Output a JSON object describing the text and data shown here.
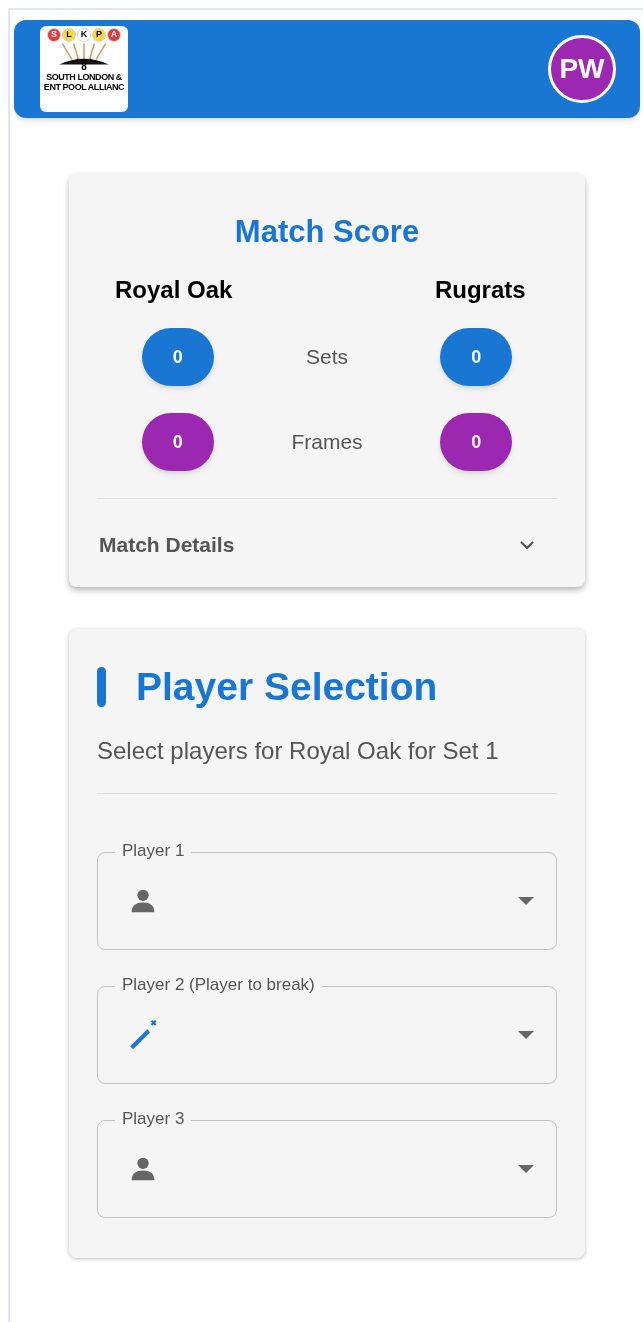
{
  "header": {
    "logo": {
      "balls": [
        {
          "letter": "S",
          "color": "#e53935"
        },
        {
          "letter": "L",
          "color": "#fdd835"
        },
        {
          "letter": "K",
          "color": "#ffffff"
        },
        {
          "letter": "P",
          "color": "#fdd835"
        },
        {
          "letter": "A",
          "color": "#e53935"
        }
      ],
      "number": "8",
      "lines": [
        "SOUTH LONDON &",
        "ENT POOL ALLIANC"
      ]
    },
    "avatar": "PW"
  },
  "match_score": {
    "title": "Match Score",
    "teams": [
      "Royal Oak",
      "Rugrats"
    ],
    "rows": [
      {
        "label": "Sets",
        "home": "0",
        "away": "0",
        "color": "#1976d2"
      },
      {
        "label": "Frames",
        "home": "0",
        "away": "0",
        "color": "#9c27b0"
      }
    ],
    "details": {
      "label": "Match Details",
      "expanded": false
    }
  },
  "player_selection": {
    "title": "Player Selection",
    "subtitle": "Select players for Royal Oak for Set 1",
    "fields": [
      {
        "label": "Player 1",
        "kind": "person"
      },
      {
        "label": "Player 2 (Player to break)",
        "kind": "break"
      },
      {
        "label": "Player 3",
        "kind": "person"
      }
    ]
  }
}
